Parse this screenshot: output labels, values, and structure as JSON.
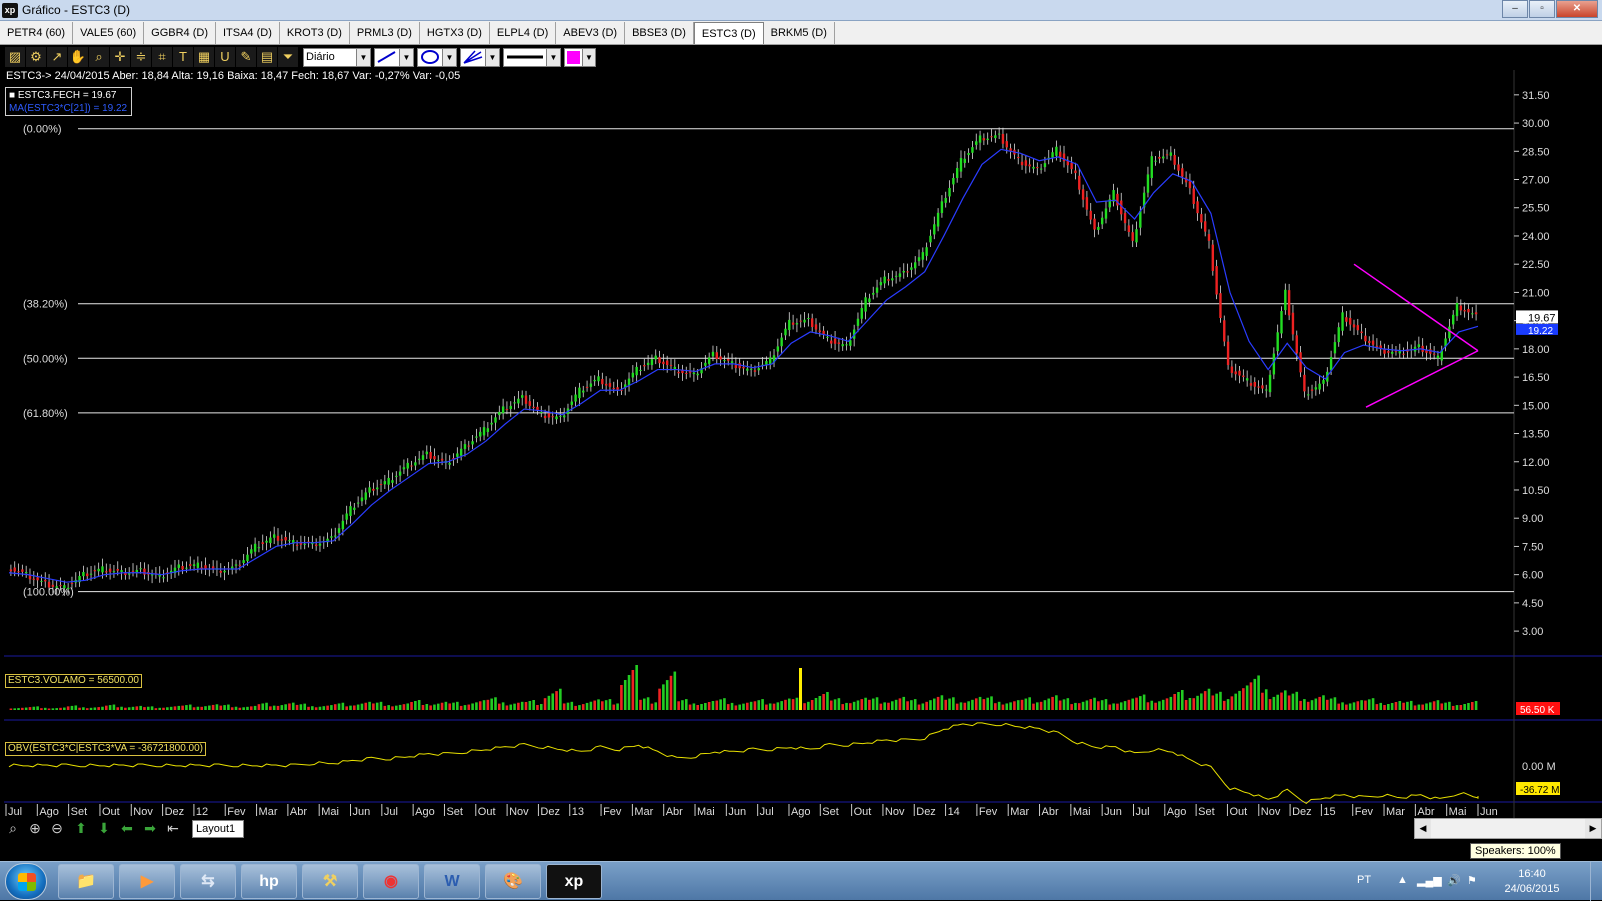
{
  "window": {
    "app_logo": "xp",
    "title": "Gráfico - ESTC3 (D)",
    "buttons": [
      "–",
      "▫",
      "✕"
    ]
  },
  "tabs": [
    {
      "label": "PETR4 (60)",
      "active": false
    },
    {
      "label": "VALE5 (60)",
      "active": false
    },
    {
      "label": "GGBR4 (D)",
      "active": false
    },
    {
      "label": "ITSA4 (D)",
      "active": false
    },
    {
      "label": "KROT3 (D)",
      "active": false
    },
    {
      "label": "PRML3 (D)",
      "active": false
    },
    {
      "label": "HGTX3 (D)",
      "active": false
    },
    {
      "label": "ELPL4 (D)",
      "active": false
    },
    {
      "label": "ABEV3 (D)",
      "active": false
    },
    {
      "label": "BBSE3 (D)",
      "active": false
    },
    {
      "label": "ESTC3 (D)",
      "active": true
    },
    {
      "label": "BRKM5 (D)",
      "active": false
    }
  ],
  "toolbar": {
    "icons": [
      "chart-icon",
      "gear-icon",
      "cursor-icon",
      "hand-icon",
      "zoom-icon",
      "crosshair-icon",
      "hlines-icon",
      "grid-icon",
      "text-icon",
      "calculator-icon",
      "magnet-icon",
      "brush-icon",
      "clipboard-icon",
      "filter-icon"
    ],
    "glyphs": [
      "▨",
      "⚙",
      "↗",
      "✋",
      "⌕",
      "✛",
      "≑",
      "⌗",
      "T",
      "▦",
      "U",
      "✎",
      "▤",
      "⏷"
    ],
    "period_value": "Diário",
    "line_color": "#ff00ff"
  },
  "info_line": "ESTC3-> 24/04/2015 Aber: 18,84 Alta: 19,16 Baixa: 18,47 Fech: 18,67 Var: -0,27% Var: -0,05",
  "legend": {
    "close_label": "ESTC3.FECH = 19.67",
    "ma_label": "MA(ESTC3*C[21]) = 19.22"
  },
  "indicators": {
    "volume_label": "ESTC3.VOLAMO = 56500.00",
    "volume_value": "56.50 K",
    "obv_label": "OBV(ESTC3*C|ESTC3*VA = -36721800.00)",
    "obv_value": "-36.72 M",
    "obv_zero_label": "0.00 M"
  },
  "chart_data": {
    "type": "line",
    "price_axis_ticks": [
      "31.50",
      "30.00",
      "28.50",
      "27.00",
      "25.50",
      "24.00",
      "22.50",
      "21.00",
      "19.50",
      "18.00",
      "16.50",
      "15.00",
      "13.50",
      "12.00",
      "10.50",
      "9.00",
      "7.50",
      "6.00",
      "4.50",
      "3.00"
    ],
    "current_price_label": "19.67",
    "ma_price_label": "19.22",
    "fibonacci_levels": [
      {
        "label": "(0.00%)",
        "price": 29.7
      },
      {
        "label": "(38.20%)",
        "price": 20.4
      },
      {
        "label": "(50.00%)",
        "price": 17.5
      },
      {
        "label": "(61.80%)",
        "price": 14.6
      },
      {
        "label": "(100.00%)",
        "price": 5.1
      }
    ],
    "x_axis_labels": [
      "Jul",
      "Ago",
      "Set",
      "Out",
      "Nov",
      "Dez",
      "12",
      "Fev",
      "Mar",
      "Abr",
      "Mai",
      "Jun",
      "Jul",
      "Ago",
      "Set",
      "Out",
      "Nov",
      "Dez",
      "13",
      "Fev",
      "Mar",
      "Abr",
      "Mai",
      "Jun",
      "Jul",
      "Ago",
      "Set",
      "Out",
      "Nov",
      "Dez",
      "14",
      "Fev",
      "Mar",
      "Abr",
      "Mai",
      "Jun",
      "Jul",
      "Ago",
      "Set",
      "Out",
      "Nov",
      "Dez",
      "15",
      "Fev",
      "Mar",
      "Abr",
      "Mai",
      "Jun"
    ],
    "close_series": [
      6.4,
      6.0,
      5.5,
      5.3,
      6.0,
      6.3,
      6.1,
      6.2,
      5.9,
      6.4,
      6.5,
      6.2,
      6.4,
      7.5,
      8.0,
      7.7,
      7.6,
      7.9,
      9.5,
      10.5,
      11.0,
      11.8,
      12.4,
      11.9,
      12.8,
      13.7,
      14.8,
      15.4,
      14.5,
      14.3,
      15.8,
      16.4,
      15.7,
      16.9,
      17.5,
      16.9,
      16.6,
      17.7,
      17.2,
      16.8,
      17.4,
      19.4,
      19.5,
      18.5,
      18.1,
      20.6,
      21.7,
      22.0,
      23.0,
      25.7,
      28.0,
      29.2,
      29.3,
      28.0,
      27.5,
      28.6,
      27.2,
      24.2,
      26.3,
      23.6,
      28.1,
      28.3,
      26.4,
      23.6,
      17.0,
      16.3,
      15.7,
      21.0,
      15.6,
      16.2,
      19.8,
      18.7,
      17.9,
      17.8,
      18.1,
      17.5,
      20.3,
      19.7
    ],
    "ma_series": [
      6.1,
      6.0,
      5.8,
      5.6,
      5.7,
      6.0,
      6.1,
      6.1,
      6.0,
      6.2,
      6.3,
      6.3,
      6.3,
      6.9,
      7.5,
      7.7,
      7.7,
      7.8,
      8.7,
      9.7,
      10.5,
      11.2,
      11.9,
      12.0,
      12.4,
      13.1,
      14.0,
      14.8,
      14.7,
      14.5,
      15.1,
      15.8,
      15.8,
      16.3,
      16.9,
      16.9,
      16.8,
      17.2,
      17.2,
      17.0,
      17.2,
      18.3,
      18.9,
      18.7,
      18.4,
      19.5,
      20.6,
      21.3,
      22.1,
      24.0,
      26.0,
      27.8,
      28.6,
      28.4,
      28.0,
      28.2,
      27.8,
      25.8,
      25.9,
      24.9,
      26.3,
      27.3,
      26.9,
      25.2,
      21.0,
      18.4,
      16.9,
      18.3,
      17.0,
      16.4,
      17.8,
      18.2,
      18.0,
      17.9,
      18.0,
      17.8,
      18.9,
      19.2
    ],
    "volume_series": [
      3,
      4,
      3,
      5,
      4,
      6,
      5,
      4,
      5,
      6,
      7,
      6,
      5,
      8,
      9,
      7,
      6,
      8,
      10,
      9,
      8,
      11,
      10,
      9,
      12,
      14,
      10,
      11,
      26,
      9,
      13,
      12,
      55,
      14,
      47,
      12,
      11,
      13,
      10,
      12,
      14,
      15,
      22,
      13,
      15,
      14,
      16,
      12,
      18,
      14,
      16,
      15,
      12,
      14,
      18,
      13,
      15,
      12,
      14,
      17,
      16,
      22,
      26,
      20,
      30,
      38,
      24,
      20,
      18,
      14,
      12,
      13,
      11,
      10,
      12,
      9,
      11,
      10
    ],
    "obv_series": [
      6,
      6,
      6,
      6,
      6,
      6,
      6,
      6,
      6,
      6,
      6,
      6,
      6,
      6,
      6,
      6,
      7,
      7,
      8,
      9,
      9,
      10,
      11,
      11,
      12,
      13,
      14,
      15,
      14,
      13,
      12,
      14,
      13,
      15,
      12,
      9,
      10,
      12,
      12,
      13,
      13,
      14,
      13,
      15,
      15,
      16,
      17,
      17,
      18,
      22,
      24,
      24,
      24,
      23,
      22,
      20,
      16,
      14,
      14,
      11,
      13,
      12,
      8,
      5,
      -4,
      -6,
      -9,
      -5,
      -10,
      -8,
      -7,
      -8,
      -7,
      -8,
      -7,
      -9,
      -6,
      -8
    ],
    "triangle_lines": {
      "upper": [
        [
          22.5,
          1354
        ],
        [
          17.9,
          1478
        ]
      ],
      "lower": [
        [
          14.9,
          1366
        ],
        [
          17.9,
          1478
        ]
      ],
      "color": "#ff00ff"
    }
  },
  "bottom_bar": {
    "layout_tab": "Layout1",
    "tooltip": "Speakers: 100%"
  },
  "taskbar": {
    "apps": [
      "explorer-icon",
      "media-player-icon",
      "network-icon",
      "hp-icon",
      "tool-icon",
      "chrome-icon",
      "word-icon",
      "paint-icon",
      "xp-app-icon"
    ],
    "app_glyphs": [
      "📁",
      "▶",
      "⇆",
      "hp",
      "⚒",
      "◉",
      "W",
      "🎨",
      "xp"
    ],
    "tray_lang": "PT",
    "tray_icons": [
      "▲",
      "▂▄▆",
      "🔊",
      "⚑"
    ],
    "clock_time": "16:40",
    "clock_date": "24/06/2015"
  }
}
